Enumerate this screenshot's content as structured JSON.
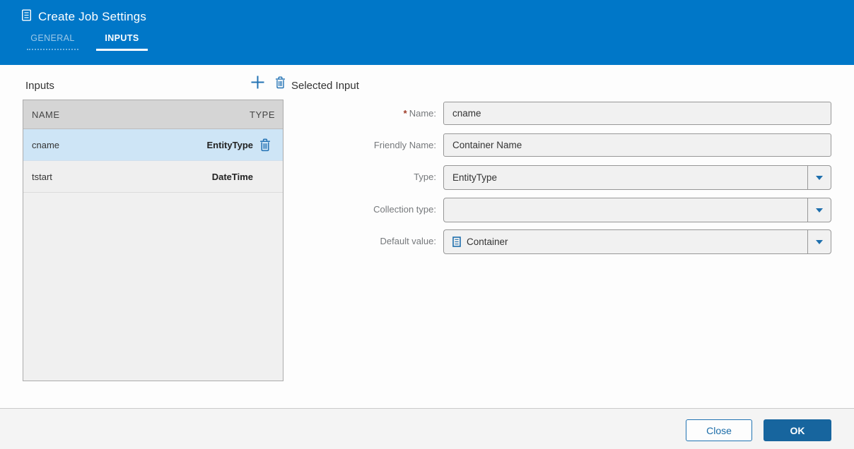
{
  "colors": {
    "header_blue": "#0077C8",
    "accent_blue": "#1B6CA8",
    "button_blue": "#17659E",
    "tab_inactive_text": "#9CC8E7",
    "selected_row_bg": "#CEE5F6",
    "table_header_bg": "#D5D5D5",
    "list_bg": "#F0F0F0",
    "input_bg": "#F1F1F1",
    "input_border": "#979797",
    "footer_bg": "#F4F4F4",
    "required_red": "#9E3A26"
  },
  "window": {
    "title": "Create Job Settings",
    "title_icon": "document-icon"
  },
  "tabs": [
    {
      "label": "GENERAL",
      "active": false
    },
    {
      "label": "INPUTS",
      "active": true
    }
  ],
  "inputs_panel": {
    "heading": "Inputs",
    "toolbar": {
      "add_icon": "plus-icon",
      "delete_icon": "trash-icon"
    },
    "table": {
      "columns": [
        "NAME",
        "TYPE"
      ],
      "rows": [
        {
          "name": "cname",
          "type": "EntityType",
          "selected": true,
          "row_delete_icon": "trash-icon"
        },
        {
          "name": "tstart",
          "type": "DateTime",
          "selected": false
        }
      ]
    }
  },
  "selected_input": {
    "heading": "Selected Input",
    "required_marker": "*",
    "fields": [
      {
        "label": "Name:",
        "required": true,
        "kind": "text",
        "value": "cname"
      },
      {
        "label": "Friendly Name:",
        "required": false,
        "kind": "text",
        "value": "Container Name"
      },
      {
        "label": "Type:",
        "required": false,
        "kind": "dropdown",
        "value": "EntityType"
      },
      {
        "label": "Collection type:",
        "required": false,
        "kind": "dropdown",
        "value": ""
      },
      {
        "label": "Default value:",
        "required": false,
        "kind": "dropdown",
        "value": "Container",
        "value_icon": "entity-list-icon"
      }
    ]
  },
  "footer": {
    "close_label": "Close",
    "ok_label": "OK"
  }
}
